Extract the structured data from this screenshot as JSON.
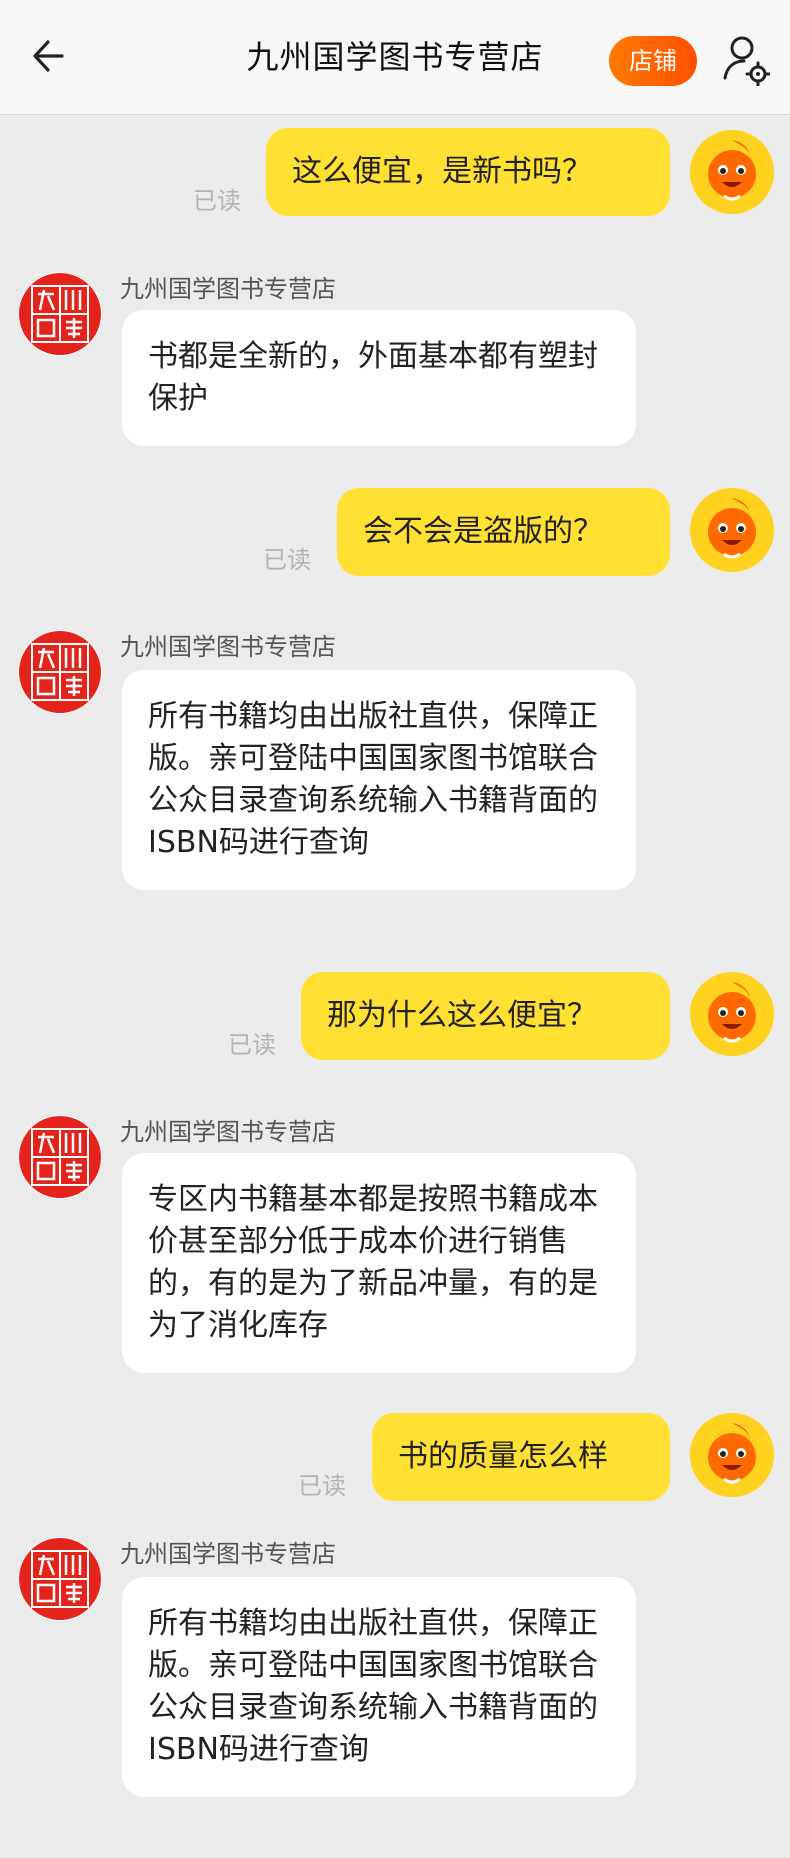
{
  "header": {
    "title": "九州国学图书专营店",
    "shop_button": "店铺"
  },
  "colors": {
    "outgoing_bubble": "#ffe033",
    "incoming_bubble": "#ffffff",
    "background": "#ebebeb",
    "shop_button": "#ff5a00",
    "read_text": "#b3b3b3"
  },
  "icons": {
    "back": "arrow-left-icon",
    "user_settings": "user-settings-icon"
  },
  "messages": [
    {
      "direction": "out",
      "text": "这么便宜，是新书吗？",
      "status": "已读"
    },
    {
      "direction": "in",
      "sender": "九州国学图书专营店",
      "text": "书都是全新的，外面基本都有塑封保护"
    },
    {
      "direction": "out",
      "text": "会不会是盗版的？",
      "status": "已读"
    },
    {
      "direction": "in",
      "sender": "九州国学图书专营店",
      "text": "所有书籍均由出版社直供，保障正版。亲可登陆中国国家图书馆联合公众目录查询系统输入书籍背面的ISBN码进行查询"
    },
    {
      "direction": "out",
      "text": "那为什么这么便宜？",
      "status": "已读"
    },
    {
      "direction": "in",
      "sender": "九州国学图书专营店",
      "text": "专区内书籍基本都是按照书籍成本价甚至部分低于成本价进行销售的，有的是为了新品冲量，有的是为了消化库存"
    },
    {
      "direction": "out",
      "text": "书的质量怎么样",
      "status": "已读"
    },
    {
      "direction": "in",
      "sender": "九州国学图书专营店",
      "text": "所有书籍均由出版社直供，保障正版。亲可登陆中国国家图书馆联合公众目录查询系统输入书籍背面的ISBN码进行查询"
    }
  ]
}
